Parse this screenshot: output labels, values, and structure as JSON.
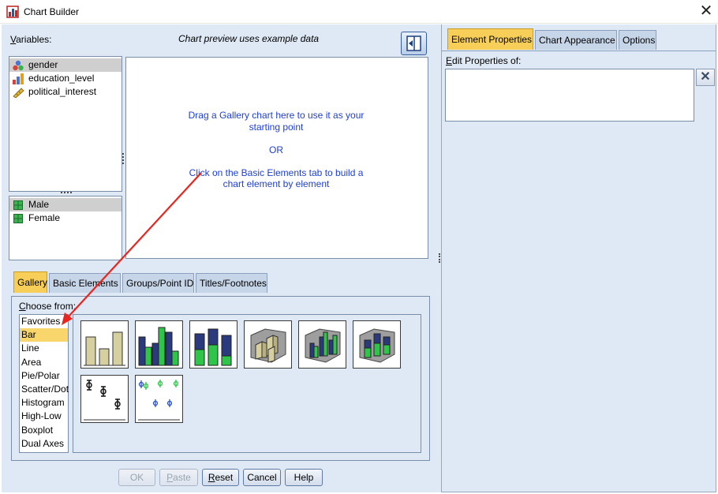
{
  "window": {
    "title": "Chart Builder"
  },
  "variables": {
    "label": "Variables:",
    "items": [
      {
        "name": "gender",
        "icon": "nominal-icon",
        "selected": true
      },
      {
        "name": "education_level",
        "icon": "ordinal-icon",
        "selected": false
      },
      {
        "name": "political_interest",
        "icon": "scale-icon",
        "selected": false
      }
    ],
    "categories": [
      {
        "name": "Male",
        "selected": true
      },
      {
        "name": "Female",
        "selected": false
      }
    ]
  },
  "preview": {
    "note": "Chart preview uses example data",
    "line1": "Drag a Gallery chart here to use it as your",
    "line2": "starting point",
    "line3": "OR",
    "line4": "Click on the Basic Elements tab to build a",
    "line5": "chart element by element"
  },
  "bottom_tabs": [
    "Gallery",
    "Basic Elements",
    "Groups/Point ID",
    "Titles/Footnotes"
  ],
  "gallery": {
    "choose_label": "Choose from:",
    "types": [
      "Favorites",
      "Bar",
      "Line",
      "Area",
      "Pie/Polar",
      "Scatter/Dot",
      "Histogram",
      "High-Low",
      "Boxplot",
      "Dual Axes"
    ],
    "selected": "Bar",
    "thumbnails": [
      "simple-bar-thumbnail",
      "clustered-bar-thumbnail",
      "stacked-bar-thumbnail",
      "3d-bar-thumbnail",
      "3d-clustered-bar-thumbnail",
      "3d-stacked-bar-thumbnail",
      "simple-error-bar-thumbnail",
      "clustered-error-bar-thumbnail"
    ]
  },
  "buttons": {
    "ok": "OK",
    "paste": "Paste",
    "reset": "Reset",
    "cancel": "Cancel",
    "help": "Help"
  },
  "right_tabs": [
    "Element Properties",
    "Chart Appearance",
    "Options"
  ],
  "properties": {
    "edit_label": "Edit Properties of:"
  },
  "colors": {
    "panel": "#dfe9f5",
    "tab_active": "#f7cf58",
    "tab_inactive": "#c6d5e8",
    "bar_beige": "#d6cfa0",
    "bar_navy": "#2b3a7d",
    "bar_green": "#2ec54a",
    "annotation_arrow": "#e8251e",
    "hint_text": "#1f3fd0"
  }
}
